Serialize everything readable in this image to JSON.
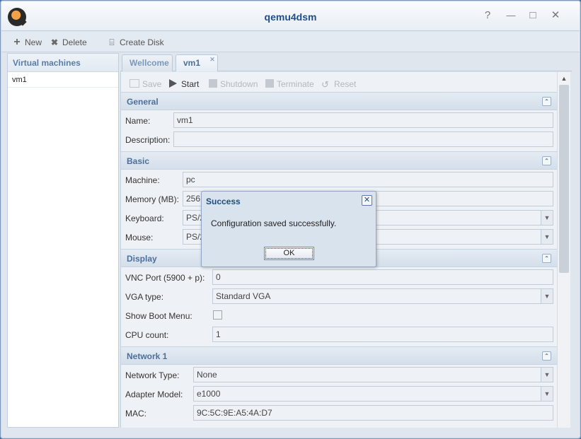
{
  "window": {
    "title": "qemu4dsm",
    "help": "?",
    "minimize": "—",
    "maximize": "□",
    "close": "✕"
  },
  "toolbar": {
    "new_label": "New",
    "delete_label": "Delete",
    "create_disk_label": "Create Disk"
  },
  "sidebar": {
    "header": "Virtual machines",
    "items": [
      {
        "label": "vm1"
      }
    ]
  },
  "tabs": [
    {
      "label": "Wellcome",
      "active": false
    },
    {
      "label": "vm1",
      "active": true,
      "closable": true
    }
  ],
  "actions": {
    "save": "Save",
    "start": "Start",
    "shutdown": "Shutdown",
    "terminate": "Terminate",
    "reset": "Reset"
  },
  "sections": {
    "general": {
      "title": "General",
      "name_label": "Name:",
      "name_value": "vm1",
      "description_label": "Description:",
      "description_value": ""
    },
    "basic": {
      "title": "Basic",
      "machine_label": "Machine:",
      "machine_value": "pc",
      "memory_label": "Memory (MB):",
      "memory_value": "256",
      "keyboard_label": "Keyboard:",
      "keyboard_value": "PS/2",
      "mouse_label": "Mouse:",
      "mouse_value": "PS/2"
    },
    "display": {
      "title": "Display",
      "vnc_label": "VNC Port (5900 + p):",
      "vnc_value": "0",
      "vga_label": "VGA type:",
      "vga_value": "Standard VGA",
      "boot_menu_label": "Show Boot Menu:",
      "boot_menu_checked": false,
      "cpu_label": "CPU count:",
      "cpu_value": "1"
    },
    "network": {
      "title": "Network 1",
      "type_label": "Network Type:",
      "type_value": "None",
      "adapter_label": "Adapter Model:",
      "adapter_value": "e1000",
      "mac_label": "MAC:",
      "mac_value": "9C:5C:9E:A5:4A:D7"
    }
  },
  "dialog": {
    "title": "Success",
    "message": "Configuration saved successfully.",
    "ok_label": "OK",
    "close_glyph": "✕"
  },
  "icons": {
    "collapse": "⌃",
    "select_arrow": "▼",
    "scroll_up": "▲"
  }
}
